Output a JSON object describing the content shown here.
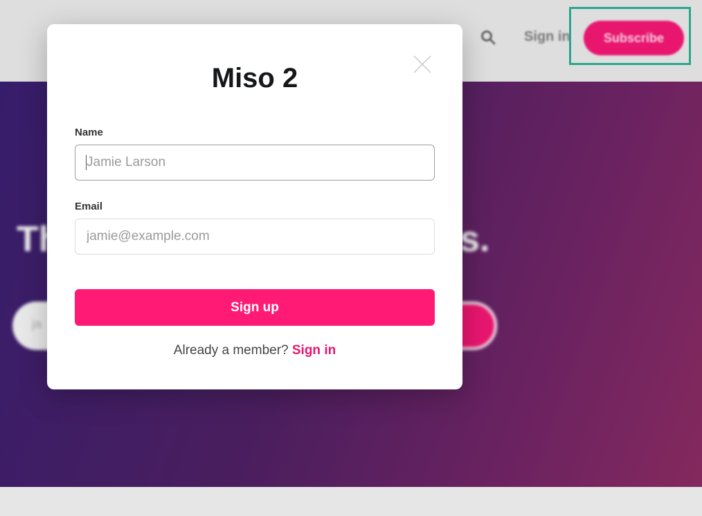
{
  "background": {
    "header": {
      "signin_label": "Sign in",
      "subscribe_label": "Subscribe",
      "search_icon": "search-icon"
    },
    "hero": {
      "title_left": "Th",
      "title_right": "s.",
      "input_hint": "ja"
    },
    "colors": {
      "accent": "#ff1a75",
      "hero_gradient_start": "#361d6b",
      "hero_gradient_end": "#84295e",
      "highlight": "#27a88c"
    }
  },
  "modal": {
    "title": "Miso 2",
    "close_icon": "close-icon",
    "name_label": "Name",
    "name_placeholder": "Jamie Larson",
    "name_value": "",
    "email_label": "Email",
    "email_placeholder": "jamie@example.com",
    "email_value": "",
    "signup_label": "Sign up",
    "member_text": "Already a member?",
    "signin_link": "Sign in"
  }
}
